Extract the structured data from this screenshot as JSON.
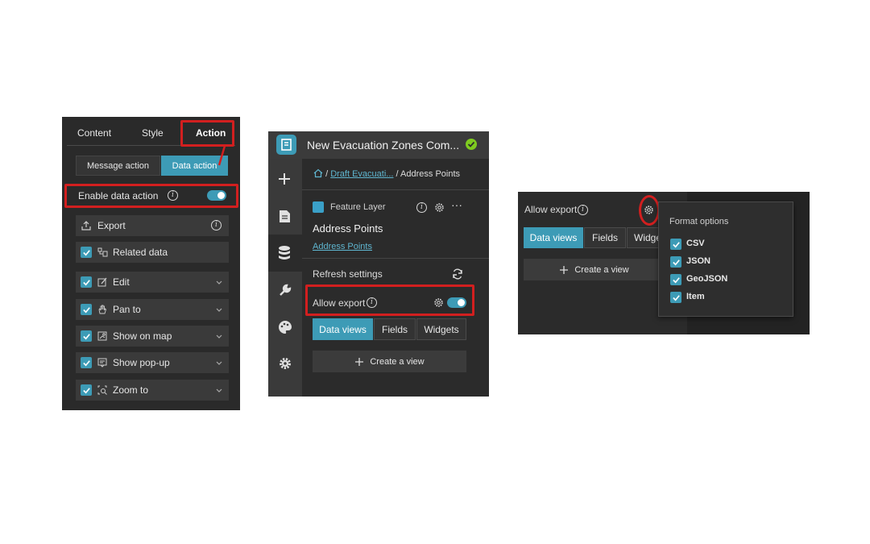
{
  "panel_a": {
    "tabs": [
      "Content",
      "Style",
      "Action"
    ],
    "segments": [
      "Message action",
      "Data action"
    ],
    "enable_label": "Enable data action",
    "export_label": "Export",
    "items": [
      {
        "label": "Related data"
      },
      {
        "label": "Edit"
      },
      {
        "label": "Pan to"
      },
      {
        "label": "Show on map"
      },
      {
        "label": "Show pop-up"
      },
      {
        "label": "Zoom to"
      }
    ]
  },
  "panel_b": {
    "app_title": "New Evacuation Zones Com...",
    "breadcrumb": {
      "link": "Draft Evacuati...",
      "separator": "/",
      "current": "Address Points"
    },
    "layer_type": "Feature Layer",
    "layer_name": "Address Points",
    "layer_link": "Address Points",
    "refresh_label": "Refresh settings",
    "allow_export_label": "Allow export",
    "tabs": [
      "Data views",
      "Fields",
      "Widgets"
    ],
    "create_view_label": "Create a view"
  },
  "panel_c": {
    "allow_export_label": "Allow export",
    "tabs": [
      "Data views",
      "Fields",
      "Widge"
    ],
    "create_view_label": "Create a view",
    "format_title": "Format options",
    "formats": [
      "CSV",
      "JSON",
      "GeoJSON",
      "Item"
    ]
  },
  "colors": {
    "accent": "#3d9bb6",
    "highlight": "#d21f1f",
    "panel": "#2b2b2b",
    "ok": "#7ecb20"
  }
}
